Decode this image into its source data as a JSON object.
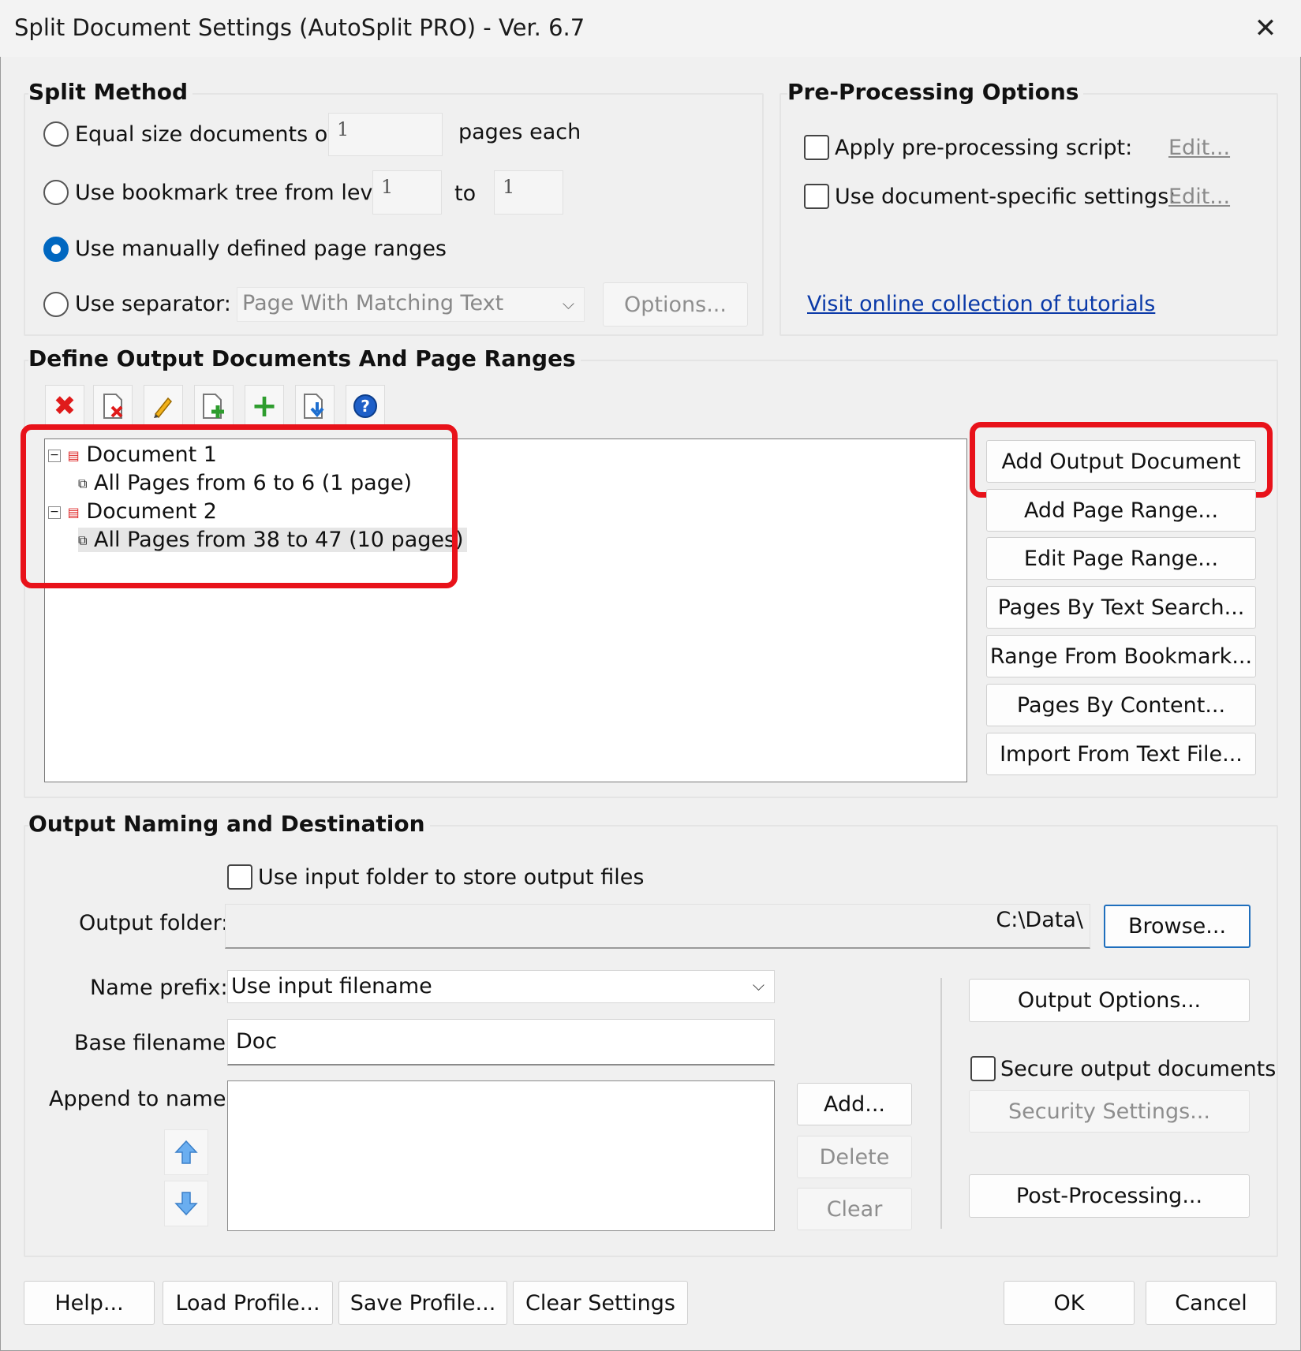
{
  "window": {
    "title": "Split Document Settings (AutoSplit PRO) - Ver. 6.7",
    "close_glyph": "✕"
  },
  "split_method": {
    "title": "Split Method",
    "equal_size_label": "Equal size documents of",
    "equal_size_value": "1",
    "pages_each_label": "pages each",
    "bookmark_label": "Use bookmark tree from level",
    "bookmark_from": "1",
    "to_label": "to",
    "bookmark_to": "1",
    "manual_label": "Use manually defined page ranges",
    "separator_label": "Use separator:",
    "separator_value": "Page With Matching Text",
    "options_button": "Options...",
    "selected": "manual"
  },
  "preprocessing": {
    "title": "Pre-Processing Options",
    "apply_script_label": "Apply pre-processing script:",
    "apply_script_edit": "Edit...",
    "doc_specific_label": "Use document-specific settings:",
    "doc_specific_edit": "Edit...",
    "tutorials_link": "Visit online collection of tutorials"
  },
  "output_docs": {
    "title": "Define Output Documents And Page Ranges",
    "toolbar_icons": [
      "delete-icon",
      "delete-document-icon",
      "edit-pencil-icon",
      "add-page-icon",
      "add-plus-icon",
      "import-down-icon",
      "help-icon"
    ],
    "tree": [
      {
        "label": "Document 1",
        "child": "All Pages from 6 to 6 (1 page)"
      },
      {
        "label": "Document 2",
        "child": "All Pages from 38 to 47 (10 pages)"
      }
    ],
    "buttons": {
      "add_output_document": "Add Output Document",
      "add_page_range": "Add Page Range...",
      "edit_page_range": "Edit Page Range...",
      "pages_by_text_search": "Pages By Text Search...",
      "range_from_bookmark": "Range From Bookmark...",
      "pages_by_content": "Pages By Content...",
      "import_from_text_file": "Import From Text File..."
    },
    "highlight_color": "#e8121a"
  },
  "naming": {
    "title": "Output Naming and Destination",
    "use_input_folder_label": "Use input folder to store output files",
    "output_folder_label": "Output folder:",
    "output_folder_value": "C:\\Data\\",
    "browse_button": "Browse...",
    "name_prefix_label": "Name prefix:",
    "name_prefix_value": "Use input filename",
    "base_filename_label": "Base filename:",
    "base_filename_value": "Doc",
    "append_label": "Append to name:",
    "add_button": "Add...",
    "delete_button": "Delete",
    "clear_button": "Clear",
    "output_options_button": "Output Options...",
    "secure_label": "Secure output documents",
    "security_settings_button": "Security Settings...",
    "post_processing_button": "Post-Processing..."
  },
  "footer": {
    "help": "Help...",
    "load_profile": "Load Profile...",
    "save_profile": "Save Profile...",
    "clear_settings": "Clear Settings",
    "ok": "OK",
    "cancel": "Cancel"
  }
}
